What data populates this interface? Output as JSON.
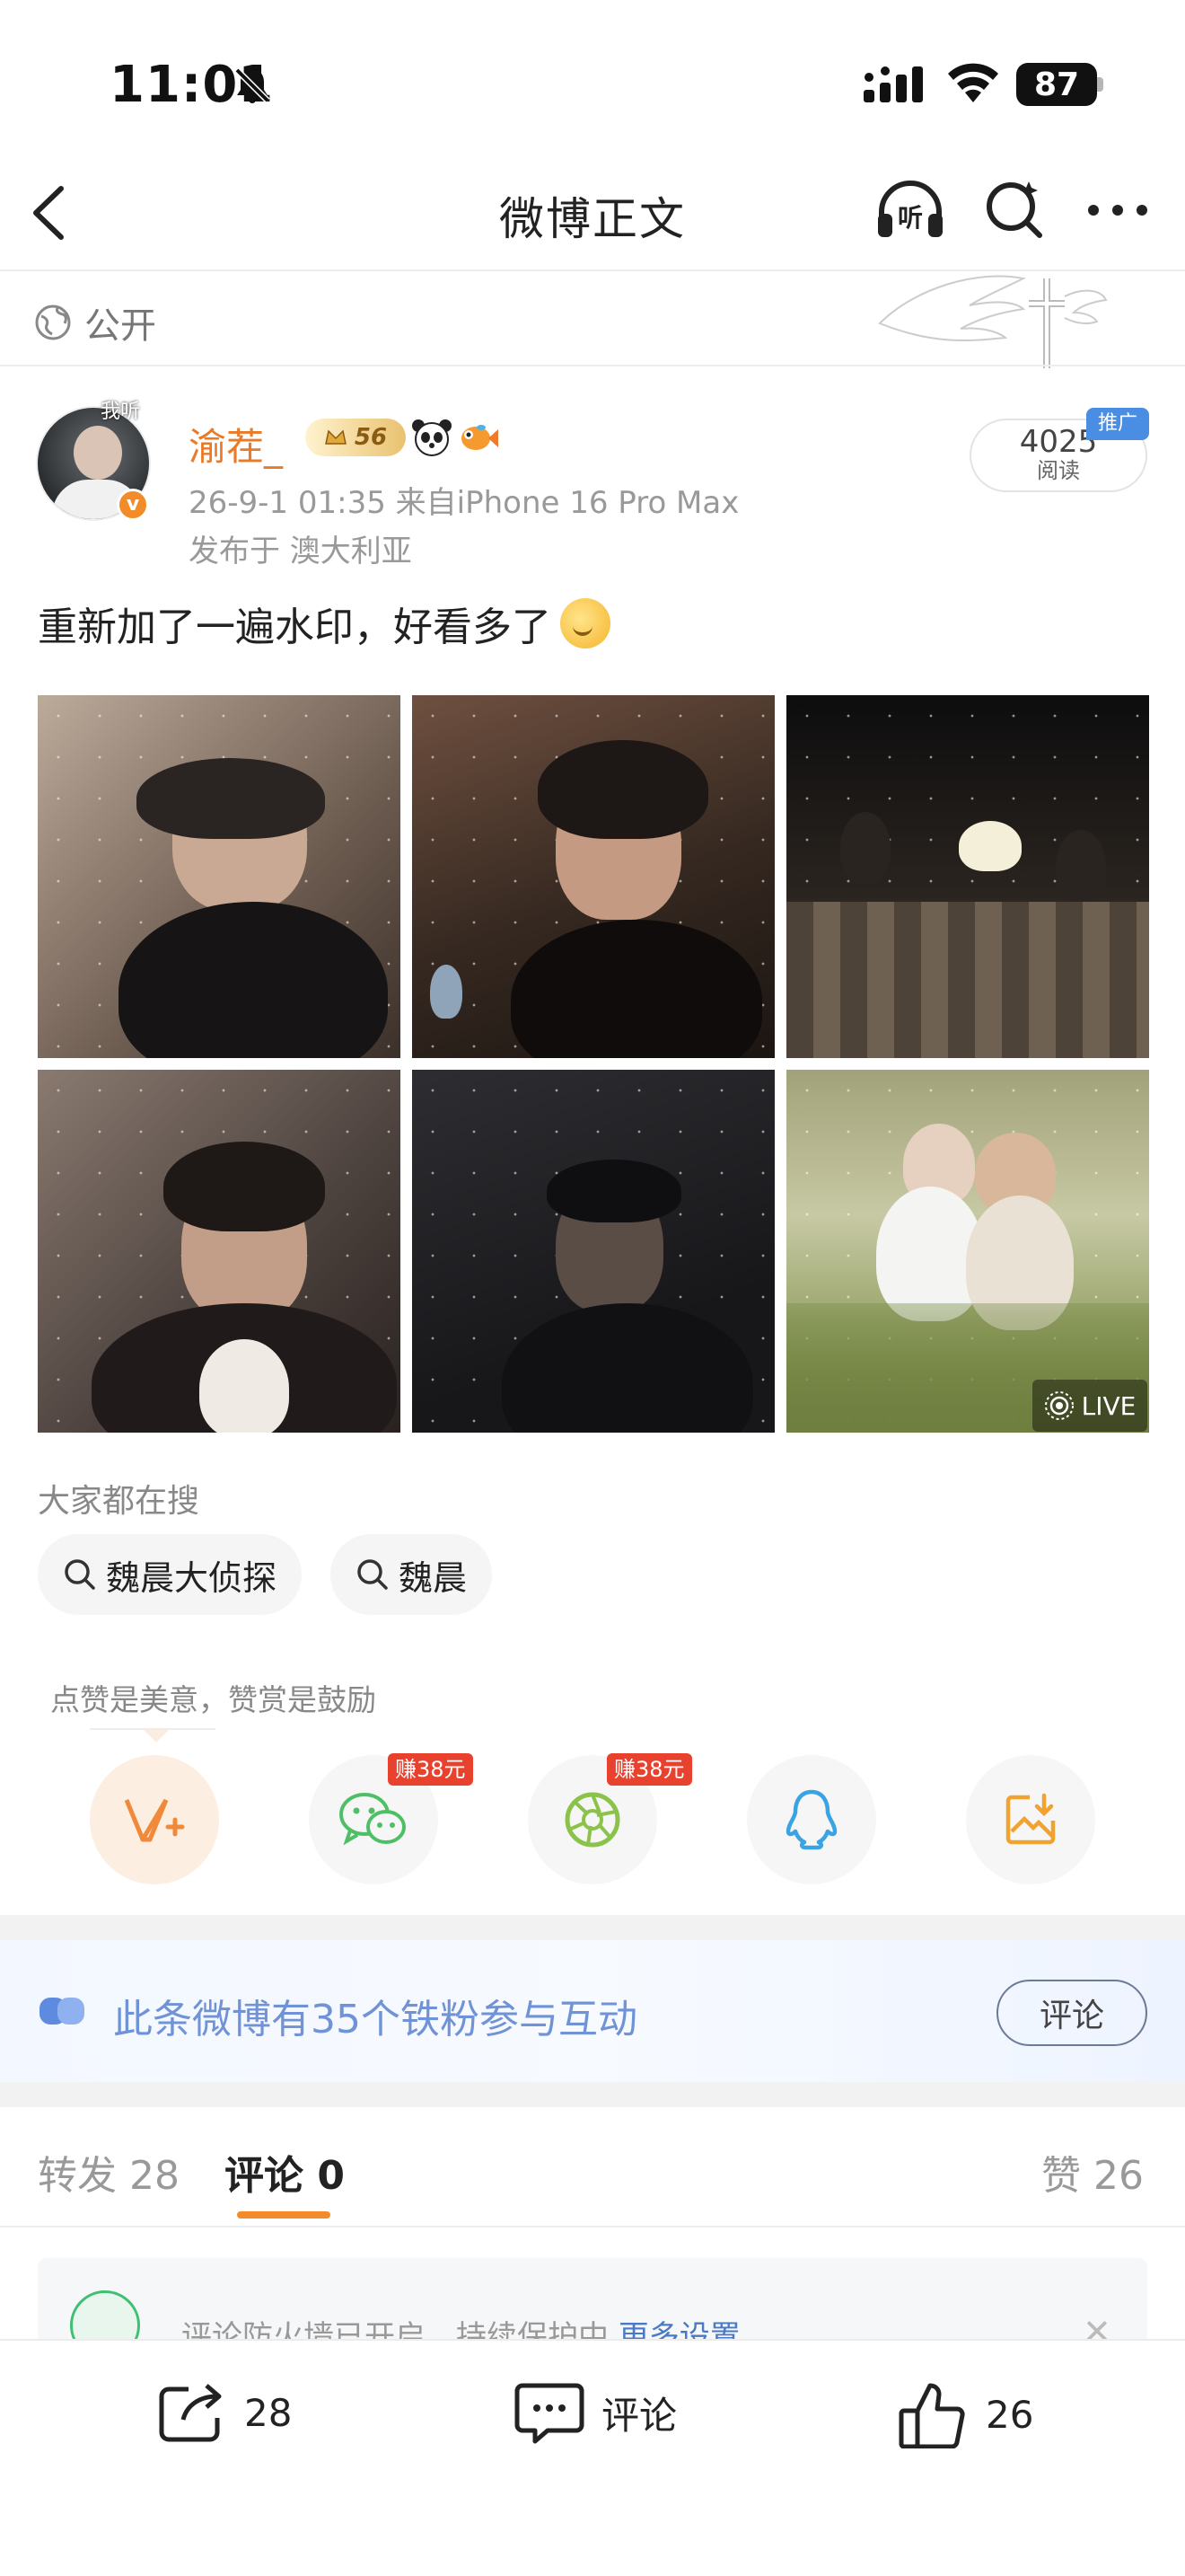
{
  "status_bar": {
    "time": "11:01",
    "battery": "87"
  },
  "nav": {
    "title": "微博正文",
    "listen_icon_text": "听"
  },
  "visibility": {
    "label": "公开"
  },
  "post": {
    "author": "渝茬_",
    "avatar_caption": "我听",
    "level_badge": "56",
    "time_source": "26-9-1 01:35  来自iPhone 16 Pro Max",
    "location": "发布于 澳大利亚",
    "reads_count": "4025",
    "reads_label": "阅读",
    "promo_label": "推广",
    "text": "重新加了一遍水印，好看多了",
    "live_label": "LIVE"
  },
  "searches": {
    "heading": "大家都在搜",
    "items": [
      "魏晨大侦探",
      "魏晨"
    ]
  },
  "reward": {
    "hint": "点赞是美意，赞赏是鼓励",
    "earn_wechat": "赚38元",
    "earn_moments": "赚38元"
  },
  "fans_banner": {
    "text": "此条微博有35个铁粉参与互动",
    "button": "评论"
  },
  "tabs": {
    "repost": "转发 28",
    "comment": "评论 0",
    "like": "赞 26"
  },
  "notice": {
    "text": "评论防火墙已开启，持续保护中 ",
    "link": "更多设置"
  },
  "bottom_bar": {
    "repost": "28",
    "comment": "评论",
    "like": "26"
  },
  "colors": {
    "accent": "#f38b28",
    "username": "#eb7a26",
    "link_blue": "#6f93d6"
  }
}
